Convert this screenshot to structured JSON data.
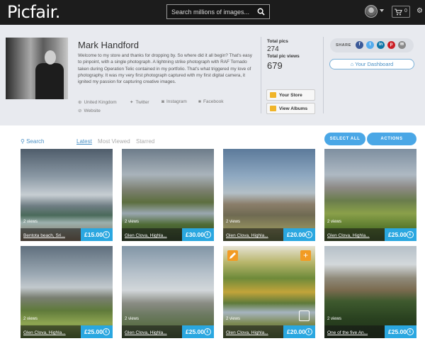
{
  "header": {
    "logo": "Picfair.",
    "search_placeholder": "Search millions of images...",
    "cart_count": "0",
    "icons": [
      "search-icon",
      "avatar",
      "chevron-down-icon",
      "cart-icon",
      "gear-icon"
    ]
  },
  "profile": {
    "name": "Mark Handford",
    "bio": "Welcome to my store and thanks for dropping by. So where did it all begin? That's easy to pinpoint, with a single photograph. A lightning strike photograph with RAF Tornado taken during Operation Telic contained in my portfolio. That's what triggered my love of photography. It was my very first photograph captured with my first digital camera, it ignited my passion for capturing creative images.",
    "location": "United Kingdom",
    "twitter": "Twitter",
    "instagram": "Instagram",
    "facebook": "Facebook",
    "website": "Website"
  },
  "stats": {
    "total_pics_label": "Total pics",
    "total_pics": "274",
    "total_views_label": "Total pic views",
    "total_views": "679"
  },
  "store_buttons": {
    "your_store": "Your Store",
    "view_albums": "View Albums"
  },
  "share": {
    "label": "SHARE",
    "colors": {
      "facebook": "#3b5998",
      "twitter": "#55acee",
      "linkedin": "#0e76a8",
      "pinterest": "#cb2027",
      "email": "#8a8a8a"
    }
  },
  "dashboard_button": "Your Dashboard",
  "toolbar": {
    "search": "Search",
    "tabs": [
      "Latest",
      "Most Viewed",
      "Starred"
    ],
    "select_all": "SELECT ALL",
    "actions": "ACTIONS"
  },
  "accent_color": "#2aa7e0",
  "grid": [
    {
      "views": "2 views",
      "title": "Bentota beach, Sri...",
      "price": "£15.00"
    },
    {
      "views": "2 views",
      "title": "Glen Clova, Highla...",
      "price": "£30.00"
    },
    {
      "views": "2 views",
      "title": "Glen Clova, Highla...",
      "price": "£20.00"
    },
    {
      "views": "2 views",
      "title": "Glen Clova, Highla...",
      "price": "£25.00"
    },
    {
      "views": "2 views",
      "title": "Glen Clova, Highla...",
      "price": "£25.00"
    },
    {
      "views": "2 views",
      "title": "Glen Clova, Highla...",
      "price": "£25.00"
    },
    {
      "views": "2 views",
      "title": "Glen Clova, Highla...",
      "price": "£20.00"
    },
    {
      "views": "2 views",
      "title": "One of the five An...",
      "price": "£25.00"
    }
  ]
}
